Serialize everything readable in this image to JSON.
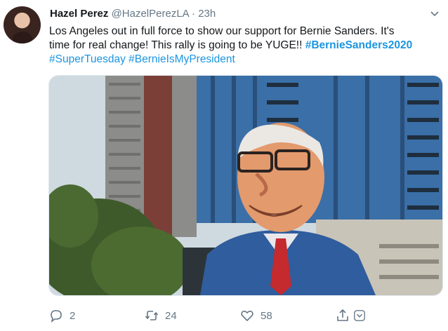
{
  "author": {
    "name": "Hazel Perez",
    "handle": "@HazelPerezLA",
    "separator": "·",
    "time": "23h"
  },
  "tweet": {
    "text_line1": "Los Angeles out in full force to show our support for Bernie Sanders. It's",
    "text_line2_plain": "time for real change! This rally is going to be YUGE!! ",
    "hashtag1": "#BernieSanders2020",
    "hashtag2": "#SuperTuesday",
    "hashtag3": "#BernieIsMyPresident"
  },
  "actions": {
    "reply_count": "2",
    "retweet_count": "24",
    "like_count": "58"
  },
  "icons": [
    "avatar",
    "chevron-down-icon",
    "reply-icon",
    "retweet-icon",
    "like-icon",
    "share-icon"
  ],
  "colors": {
    "hashtag": "#1b95e0",
    "muted": "#657786",
    "text": "#14171a"
  }
}
